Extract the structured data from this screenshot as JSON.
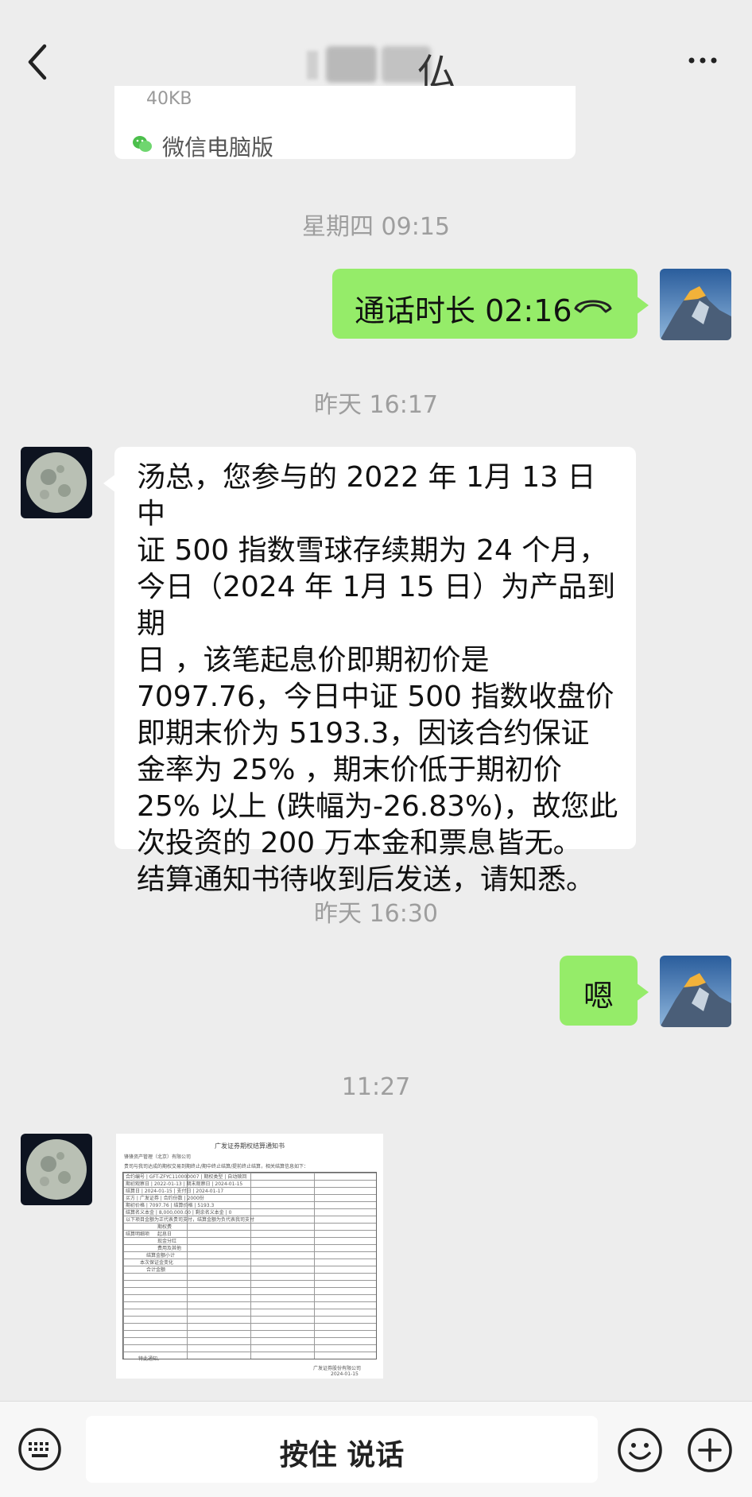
{
  "header": {
    "title_visible_fragment": "仏",
    "more_icon": "more-icon"
  },
  "shared_card": {
    "truncated_text": "40KB",
    "source_label": "微信电脑版"
  },
  "messages": {
    "ts1": "星期四 09:15",
    "call_label": "通话时长 02:16",
    "ts2": "昨天 16:17",
    "long_message": "汤总，您参与的 2022 年 1月 13 日中\n证 500 指数雪球存续期为 24 个月，\n今日（2024 年 1月 15 日）为产品到期\n日 ，该笔起息价即期初价是\n7097.76，今日中证 500 指数收盘价\n即期末价为 5193.3，因该合约保证\n金率为 25% ，期末价低于期初价\n25% 以上 (跌幅为-26.83%)，故您此\n次投资的 200 万本金和票息皆无。\n结算通知书待收到后发送，请知悉。",
    "ts3": "昨天 16:30",
    "reply": "嗯",
    "ts4": "11:27"
  },
  "document": {
    "header": "广发证券期权结算通知书",
    "company": "锋锋资产管理（北京）有限公司",
    "intro": "贵司与我司达成的期权交易到期终止/期中终止结算/提前终止结算，相关结算信息如下：",
    "rows": [
      "合约编号 | GFT-ZFYC110000007 | 期权类型 | 自动赎回",
      "期初观察日 | 2022-01-13 | 期末观察日 | 2024-01-15",
      "结算日 | 2024-01-15 | 支付日 | 2024-01-17",
      "买方 | 广发证券 | 合约份数 | 2000份",
      "期初价格 | 7097.76 | 结算价格 | 5193.3",
      "结算名义本金 | 8,000,000.00 | 剩余名义本金 | 0"
    ],
    "notes": "以下项目金额为正代表贵司支付，结算金额为负代表我司支付",
    "sub_labels": [
      "结算明细项",
      "期权费",
      "起息日",
      "现金分红",
      "费用及其他",
      "结算金额小计",
      "本次保证金变化",
      "合计金额"
    ],
    "footer_left": "特此通知。",
    "footer_right": "广发证券股份有限公司",
    "footer_date": "2024-01-15"
  },
  "bottom": {
    "speak_label": "按住 说话"
  },
  "colors": {
    "background": "#ededed",
    "green_bubble": "#95ec69",
    "white_bubble": "#ffffff",
    "timestamp": "#9e9e9e"
  },
  "icons": [
    "back-icon",
    "more-icon",
    "wechat-pc-icon",
    "hangup-icon",
    "keyboard-icon",
    "emoji-icon",
    "plus-icon"
  ]
}
